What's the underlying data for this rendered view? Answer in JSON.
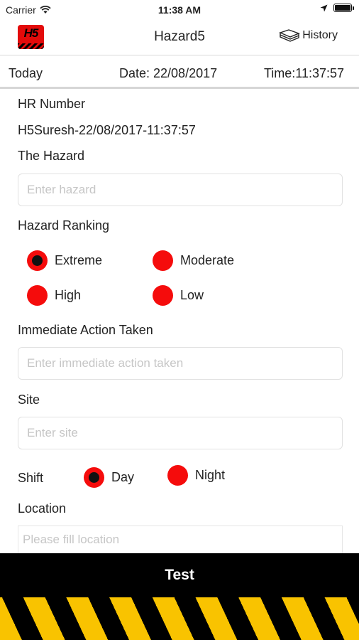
{
  "status_bar": {
    "carrier": "Carrier",
    "time": "11:38 AM",
    "wifi_icon": "wifi-icon",
    "location_icon": "location-arrow-icon",
    "battery_icon": "battery-full-icon"
  },
  "nav": {
    "logo_text": "H5",
    "title": "Hazard5",
    "history_label": "History",
    "history_icon": "book-stack-icon"
  },
  "info": {
    "today": "Today",
    "date": "Date: 22/08/2017",
    "time": "Time:11:37:57"
  },
  "form": {
    "hr_label": "HR Number",
    "hr_value": "H5Suresh-22/08/2017-11:37:57",
    "hazard_label": "The Hazard",
    "hazard_placeholder": "Enter hazard",
    "ranking_label": "Hazard Ranking",
    "ranking_options": [
      {
        "label": "Extreme",
        "selected": true
      },
      {
        "label": "Moderate",
        "selected": false
      },
      {
        "label": "High",
        "selected": false
      },
      {
        "label": "Low",
        "selected": false
      }
    ],
    "action_label": "Immediate Action Taken",
    "action_placeholder": "Enter immediate action taken",
    "site_label": "Site",
    "site_placeholder": "Enter site",
    "shift_label": "Shift",
    "shift_options": [
      {
        "label": "Day",
        "selected": true
      },
      {
        "label": "Night",
        "selected": false
      }
    ],
    "location_label": "Location",
    "location_placeholder": "Please fill location"
  },
  "bottom": {
    "test_label": "Test"
  },
  "colors": {
    "radio_red": "#f50c0c",
    "stripe_yellow": "#f9c300",
    "bar_black": "#000000"
  }
}
